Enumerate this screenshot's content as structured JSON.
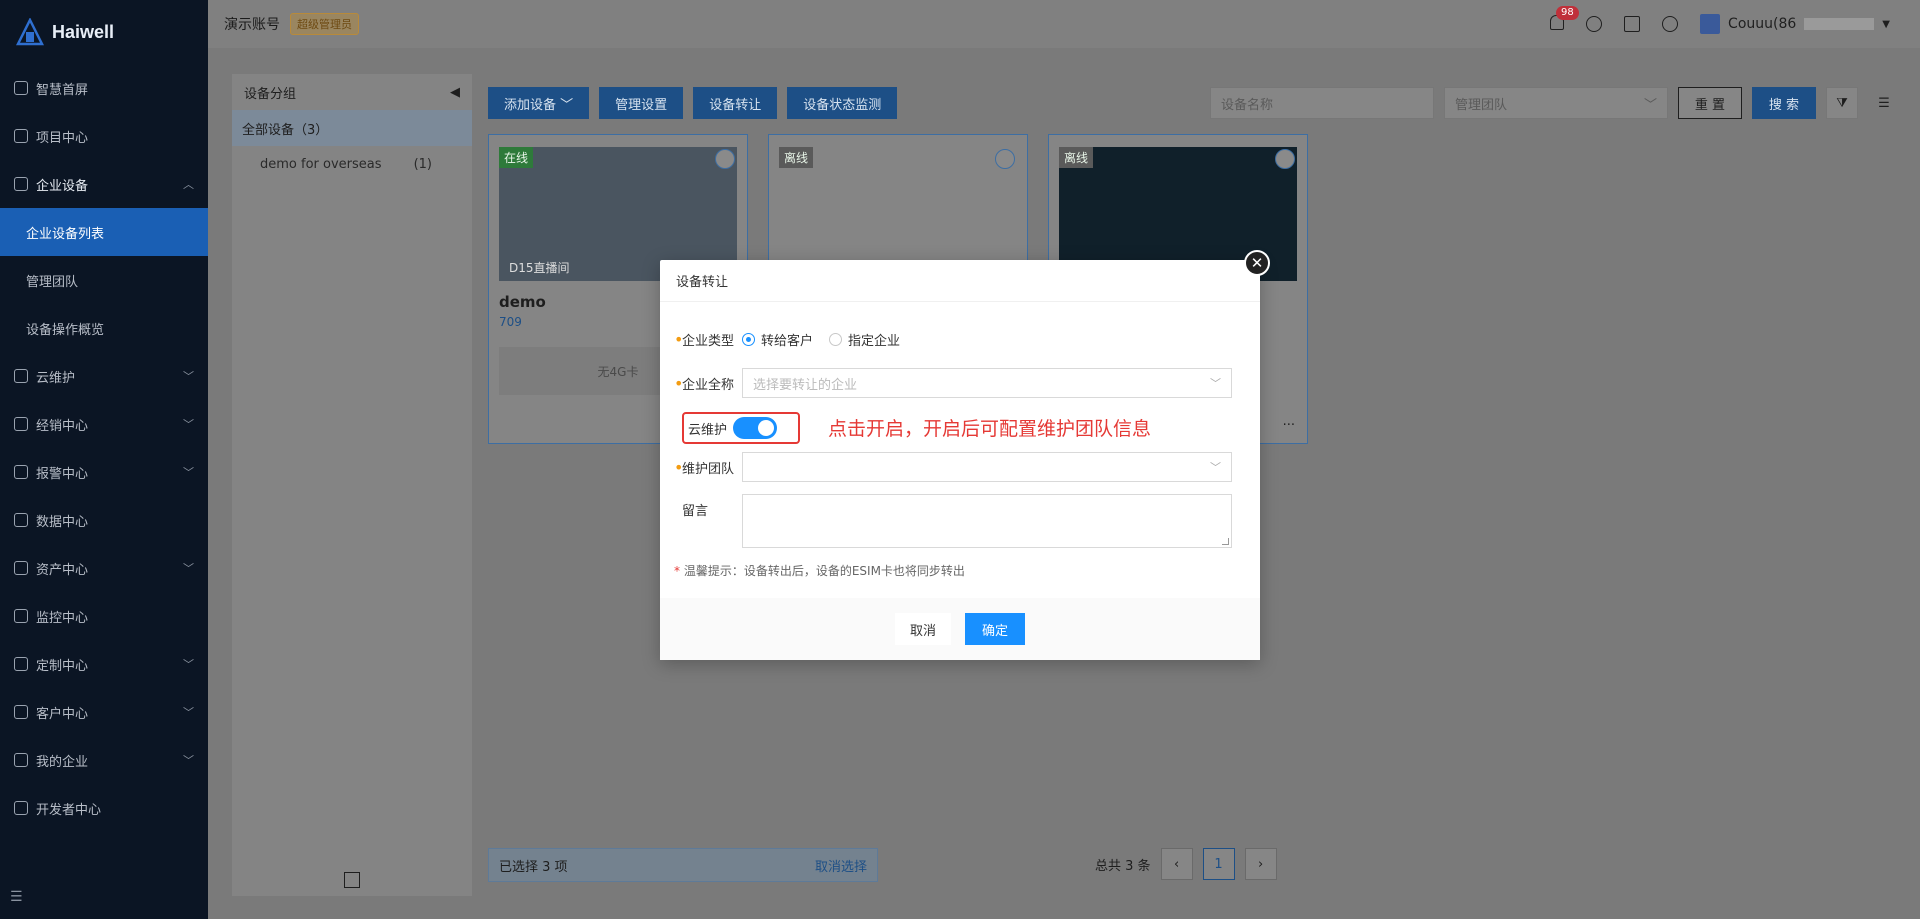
{
  "brand": "Haiwell",
  "sidebar": {
    "items": [
      {
        "label": "智慧首屏"
      },
      {
        "label": "项目中心"
      },
      {
        "label": "企业设备"
      },
      {
        "label": "云维护"
      },
      {
        "label": "经销中心"
      },
      {
        "label": "报警中心"
      },
      {
        "label": "数据中心"
      },
      {
        "label": "资产中心"
      },
      {
        "label": "监控中心"
      },
      {
        "label": "定制中心"
      },
      {
        "label": "客户中心"
      },
      {
        "label": "我的企业"
      },
      {
        "label": "开发者中心"
      }
    ],
    "sub_items": [
      {
        "label": "企业设备列表"
      },
      {
        "label": "管理团队"
      },
      {
        "label": "设备操作概览"
      }
    ]
  },
  "topbar": {
    "account": "演示账号",
    "role": "超级管理员",
    "notif_count": "98",
    "user": "Couuu(86"
  },
  "left_panel": {
    "title": "设备分组",
    "all_label": "全部设备（3）",
    "groups": [
      {
        "name": "demo for overseas",
        "count": "(1)"
      }
    ]
  },
  "toolbar": {
    "add_device": "添加设备",
    "manage_settings": "管理设置",
    "transfer": "设备转让",
    "status_monitor": "设备状态监测"
  },
  "search": {
    "device_name_placeholder": "设备名称",
    "team_placeholder": "管理团队",
    "reset": "重 置",
    "search": "搜 索"
  },
  "cards": [
    {
      "status": "在线",
      "name": "demo",
      "id": "709",
      "foot": "无4G卡",
      "caption": "D15直播间"
    },
    {
      "status": "离线"
    },
    {
      "status": "离线"
    }
  ],
  "bottom": {
    "selected": "已选择 3 项",
    "cancel_select": "取消选择",
    "total": "总共 3 条",
    "page": "1"
  },
  "modal": {
    "title": "设备转让",
    "enterprise_type_label": "企业类型",
    "option_customer": "转给客户",
    "option_enterprise": "指定企业",
    "enterprise_name_label": "企业全称",
    "enterprise_name_placeholder": "选择要转让的企业",
    "cloud_maint_label": "云维护",
    "annotation": "点击开启，开启后可配置维护团队信息",
    "maint_team_label": "维护团队",
    "message_label": "留言",
    "tip": "温馨提示：设备转出后，设备的ESIM卡也将同步转出",
    "cancel": "取消",
    "ok": "确定"
  }
}
